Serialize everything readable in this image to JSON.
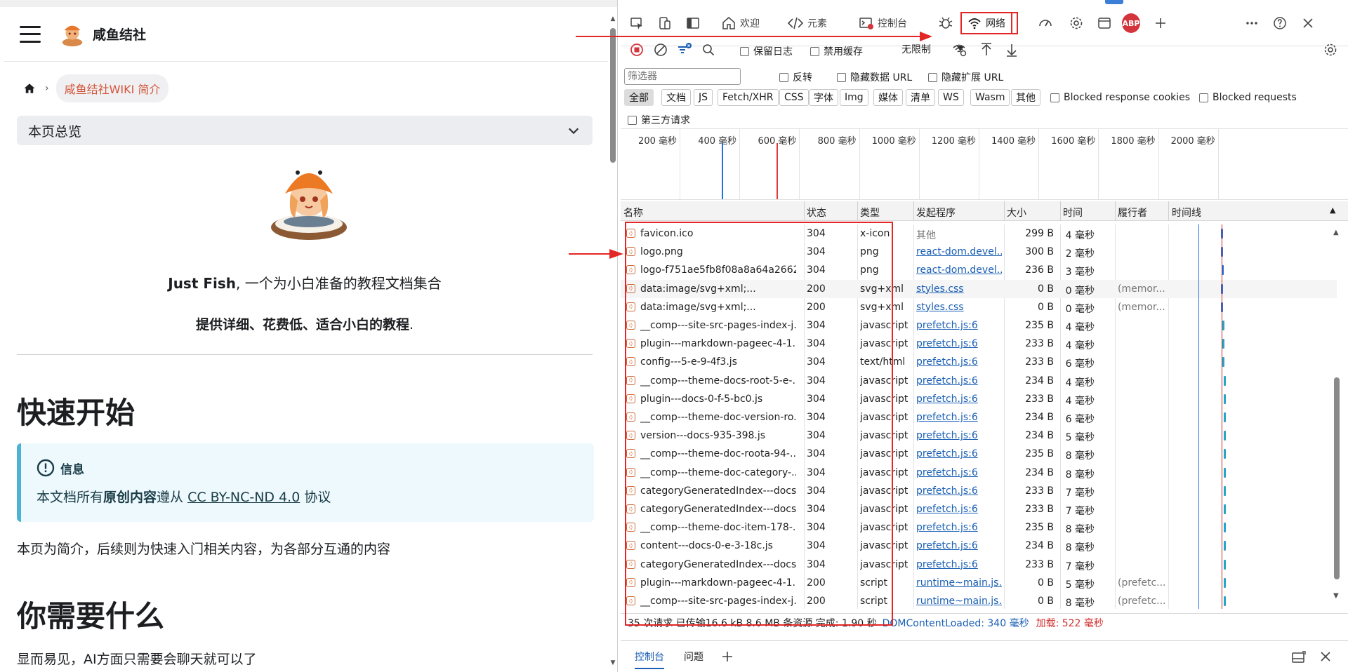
{
  "left": {
    "site_title": "咸鱼结社",
    "breadcrumb": "咸鱼结社WIKI 简介",
    "toc_label": "本页总览",
    "tagline_strong": "Just Fish",
    "tagline_rest": ", 一个为小白准备的教程文档集合",
    "tagline2": "提供详细、花费低、适合小白的教程",
    "tagline2_end": ".",
    "h_quickstart": "快速开始",
    "admonition_title": "信息",
    "admonition_pre": "本文档所有",
    "admonition_bold": "原创内容",
    "admonition_mid": "遵从 ",
    "admonition_link": "CC BY-NC-ND 4.0",
    "admonition_post": " 协议",
    "para1": "本页为简介，后续则为快速入门相关内容，为各部分互通的内容",
    "h_what": "你需要什么",
    "para2": "显而易见，AI方面只需要会聊天就可以了"
  },
  "devtools": {
    "tabs": {
      "welcome": "欢迎",
      "elements": "元素",
      "console": "控制台",
      "network": "网络"
    },
    "abp": "ABP",
    "toolbar": {
      "preserve_log": "保留日志",
      "disable_cache": "禁用缓存",
      "throttle": "无限制"
    },
    "filter": {
      "placeholder": "筛选器",
      "invert": "反转",
      "hide_data_urls": "隐藏数据 URL",
      "hide_ext_urls": "隐藏扩展 URL",
      "third_party": "第三方请求",
      "blocked_cookies": "Blocked response cookies",
      "blocked_requests": "Blocked requests"
    },
    "chips": [
      "全部",
      "文档",
      "JS",
      "Fetch/XHR",
      "CSS",
      "字体",
      "Img",
      "媒体",
      "清单",
      "WS",
      "Wasm",
      "其他"
    ],
    "overview_ticks": [
      "200 毫秒",
      "400 毫秒",
      "600 毫秒",
      "800 毫秒",
      "1000 毫秒",
      "1200 毫秒",
      "1400 毫秒",
      "1600 毫秒",
      "1800 毫秒",
      "2000 毫秒"
    ],
    "columns": {
      "name": "名称",
      "status": "状态",
      "type": "类型",
      "initiator": "发起程序",
      "size": "大小",
      "time": "时间",
      "fulfilled": "履行者",
      "waterfall": "时间线"
    },
    "rows": [
      {
        "name": "favicon.ico",
        "status": "304",
        "type": "x-icon",
        "initiator": "其他",
        "size": "299 B",
        "time": "4 毫秒",
        "fulfilled": "",
        "wf": 0.68
      },
      {
        "name": "logo.png",
        "status": "304",
        "type": "png",
        "initiator": "react-dom.devel...",
        "size": "300 B",
        "time": "2 毫秒",
        "fulfilled": "",
        "wf": 0.68
      },
      {
        "name": "logo-f751ae5fb8f08a8a64a2662...",
        "status": "304",
        "type": "png",
        "initiator": "react-dom.devel...",
        "size": "236 B",
        "time": "3 毫秒",
        "fulfilled": "",
        "wf": 0.69
      },
      {
        "name": "data:image/svg+xml;...",
        "status": "200",
        "type": "svg+xml",
        "initiator": "styles.css",
        "size": "0 B",
        "time": "0 毫秒",
        "fulfilled": "(memor...",
        "wf": 0.68
      },
      {
        "name": "data:image/svg+xml;...",
        "status": "200",
        "type": "svg+xml",
        "initiator": "styles.css",
        "size": "0 B",
        "time": "0 毫秒",
        "fulfilled": "(memor...",
        "wf": 0.68
      },
      {
        "name": "__comp---site-src-pages-index-j...",
        "status": "304",
        "type": "javascript",
        "initiator": "prefetch.js:6",
        "size": "235 B",
        "time": "4 毫秒",
        "fulfilled": "",
        "wf": 0.7
      },
      {
        "name": "plugin---markdown-pageec-4-1...",
        "status": "304",
        "type": "javascript",
        "initiator": "prefetch.js:6",
        "size": "233 B",
        "time": "4 毫秒",
        "fulfilled": "",
        "wf": 0.7
      },
      {
        "name": "config---5-e-9-4f3.js",
        "status": "304",
        "type": "text/html",
        "initiator": "prefetch.js:6",
        "size": "233 B",
        "time": "6 毫秒",
        "fulfilled": "",
        "wf": 0.7
      },
      {
        "name": "__comp---theme-docs-root-5-e-...",
        "status": "304",
        "type": "javascript",
        "initiator": "prefetch.js:6",
        "size": "234 B",
        "time": "4 毫秒",
        "fulfilled": "",
        "wf": 0.72
      },
      {
        "name": "plugin---docs-0-f-5-bc0.js",
        "status": "304",
        "type": "javascript",
        "initiator": "prefetch.js:6",
        "size": "233 B",
        "time": "4 毫秒",
        "fulfilled": "",
        "wf": 0.72
      },
      {
        "name": "__comp---theme-doc-version-ro...",
        "status": "304",
        "type": "javascript",
        "initiator": "prefetch.js:6",
        "size": "234 B",
        "time": "6 毫秒",
        "fulfilled": "",
        "wf": 0.72
      },
      {
        "name": "version---docs-935-398.js",
        "status": "304",
        "type": "javascript",
        "initiator": "prefetch.js:6",
        "size": "234 B",
        "time": "5 毫秒",
        "fulfilled": "",
        "wf": 0.72
      },
      {
        "name": "__comp---theme-doc-roota-94-...",
        "status": "304",
        "type": "javascript",
        "initiator": "prefetch.js:6",
        "size": "235 B",
        "time": "8 毫秒",
        "fulfilled": "",
        "wf": 0.72
      },
      {
        "name": "__comp---theme-doc-category-...",
        "status": "304",
        "type": "javascript",
        "initiator": "prefetch.js:6",
        "size": "234 B",
        "time": "8 毫秒",
        "fulfilled": "",
        "wf": 0.72
      },
      {
        "name": "categoryGeneratedIndex---docs...",
        "status": "304",
        "type": "javascript",
        "initiator": "prefetch.js:6",
        "size": "233 B",
        "time": "7 毫秒",
        "fulfilled": "",
        "wf": 0.72
      },
      {
        "name": "categoryGeneratedIndex---docs...",
        "status": "304",
        "type": "javascript",
        "initiator": "prefetch.js:6",
        "size": "233 B",
        "time": "7 毫秒",
        "fulfilled": "",
        "wf": 0.72
      },
      {
        "name": "__comp---theme-doc-item-178-...",
        "status": "304",
        "type": "javascript",
        "initiator": "prefetch.js:6",
        "size": "235 B",
        "time": "8 毫秒",
        "fulfilled": "",
        "wf": 0.72
      },
      {
        "name": "content---docs-0-e-3-18c.js",
        "status": "304",
        "type": "javascript",
        "initiator": "prefetch.js:6",
        "size": "234 B",
        "time": "8 毫秒",
        "fulfilled": "",
        "wf": 0.72
      },
      {
        "name": "categoryGeneratedIndex---docs...",
        "status": "304",
        "type": "javascript",
        "initiator": "prefetch.js:6",
        "size": "233 B",
        "time": "7 毫秒",
        "fulfilled": "",
        "wf": 0.72
      },
      {
        "name": "plugin---markdown-pageec-4-1...",
        "status": "200",
        "type": "script",
        "initiator": "runtime~main.js...",
        "size": "0 B",
        "time": "5 毫秒",
        "fulfilled": "(prefetc...",
        "wf": 0.72
      },
      {
        "name": "__comp---site-src-pages-index-j...",
        "status": "200",
        "type": "script",
        "initiator": "runtime~main.js...",
        "size": "0 B",
        "time": "8 毫秒",
        "fulfilled": "(prefetc...",
        "wf": 0.72
      }
    ],
    "status_bar": {
      "summary": "35 次请求  已传输16.6 kB  8.6 MB 条资源  完成: 1.90 秒",
      "dcl": "DOMContentLoaded: 340 毫秒",
      "load": "加载: 522 毫秒"
    },
    "drawer": {
      "console": "控制台",
      "issues": "问题"
    }
  },
  "colors": {
    "accent_red": "#e32626",
    "link_blue": "#1a5fb4",
    "breadcrumb_orange": "#d2553a",
    "info_border": "#4cb3d4"
  }
}
